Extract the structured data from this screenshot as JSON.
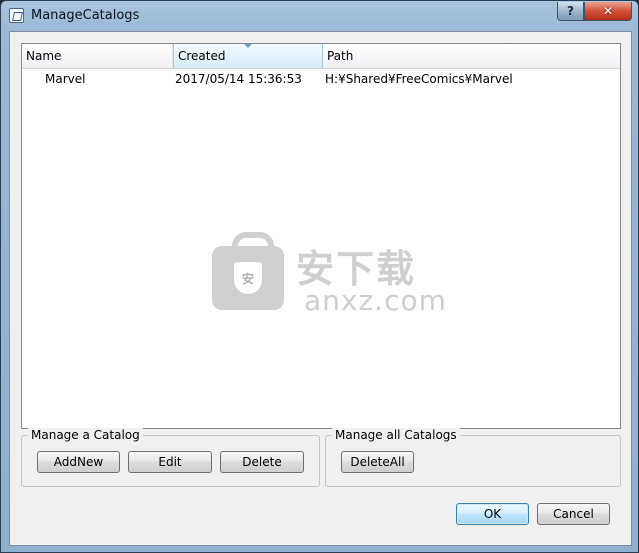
{
  "window": {
    "title": "ManageCatalogs",
    "help_label": "?",
    "close_label": "✕"
  },
  "list": {
    "columns": [
      "Name",
      "Created",
      "Path"
    ],
    "rows": [
      {
        "name": "Marvel",
        "created": "2017/05/14 15:36:53",
        "path": "H:¥Shared¥FreeComics¥Marvel"
      }
    ]
  },
  "watermark": {
    "shield_text": "安",
    "cn": "安下载",
    "en": "anxz.com"
  },
  "manage_catalog": {
    "label": "Manage a Catalog",
    "add": "AddNew",
    "edit": "Edit",
    "delete": "Delete"
  },
  "manage_all": {
    "label": "Manage all Catalogs",
    "delete_all": "DeleteAll"
  },
  "footer": {
    "ok": "OK",
    "cancel": "Cancel"
  },
  "colors": {
    "titlebar": "#a9c4de",
    "dialog_bg": "#f0f0f0",
    "close_button": "#d4533a",
    "sort_header": "#e3f1fb"
  }
}
